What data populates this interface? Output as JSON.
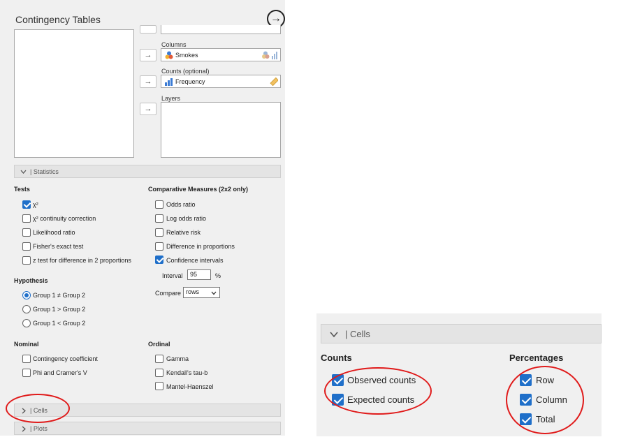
{
  "panel": {
    "title": "Contingency Tables",
    "columns_label": "Columns",
    "columns_value": "Smokes",
    "counts_label": "Counts (optional)",
    "counts_value": "Frequency",
    "layers_label": "Layers",
    "arrow_glyph": "→",
    "forward_glyph": "→"
  },
  "statistics": {
    "header": "| Statistics",
    "tests_heading": "Tests",
    "tests": [
      "χ²",
      "χ² continuity correction",
      "Likelihood ratio",
      "Fisher's exact test",
      "z test for difference in 2 proportions"
    ],
    "tests_checked": [
      true,
      false,
      false,
      false,
      false
    ],
    "comparative_heading": "Comparative Measures (2x2 only)",
    "comparative": [
      "Odds ratio",
      "Log odds ratio",
      "Relative risk",
      "Difference in proportions",
      "Confidence intervals"
    ],
    "comparative_checked": [
      false,
      false,
      false,
      false,
      true
    ],
    "interval_label": "Interval",
    "interval_value": "95",
    "interval_unit": "%",
    "compare_label": "Compare",
    "compare_value": "rows",
    "hypothesis_heading": "Hypothesis",
    "hypothesis": [
      "Group 1 ≠ Group 2",
      "Group 1 > Group 2",
      "Group 1 < Group 2"
    ],
    "hypothesis_selected": 0,
    "nominal_heading": "Nominal",
    "nominal": [
      "Contingency coefficient",
      "Phi and Cramer's V"
    ],
    "ordinal_heading": "Ordinal",
    "ordinal": [
      "Gamma",
      "Kendall's tau-b",
      "Mantel-Haenszel"
    ]
  },
  "cells_header": "| Cells",
  "plots_header": "| Plots",
  "zoom": {
    "header": "| Cells",
    "counts_heading": "Counts",
    "counts": [
      "Observed counts",
      "Expected counts"
    ],
    "percentages_heading": "Percentages",
    "percentages": [
      "Row",
      "Column",
      "Total"
    ]
  },
  "colors": {
    "accent": "#1f6fc9",
    "annotation": "#e01a1a",
    "panel_bg": "#f0f0f0"
  }
}
